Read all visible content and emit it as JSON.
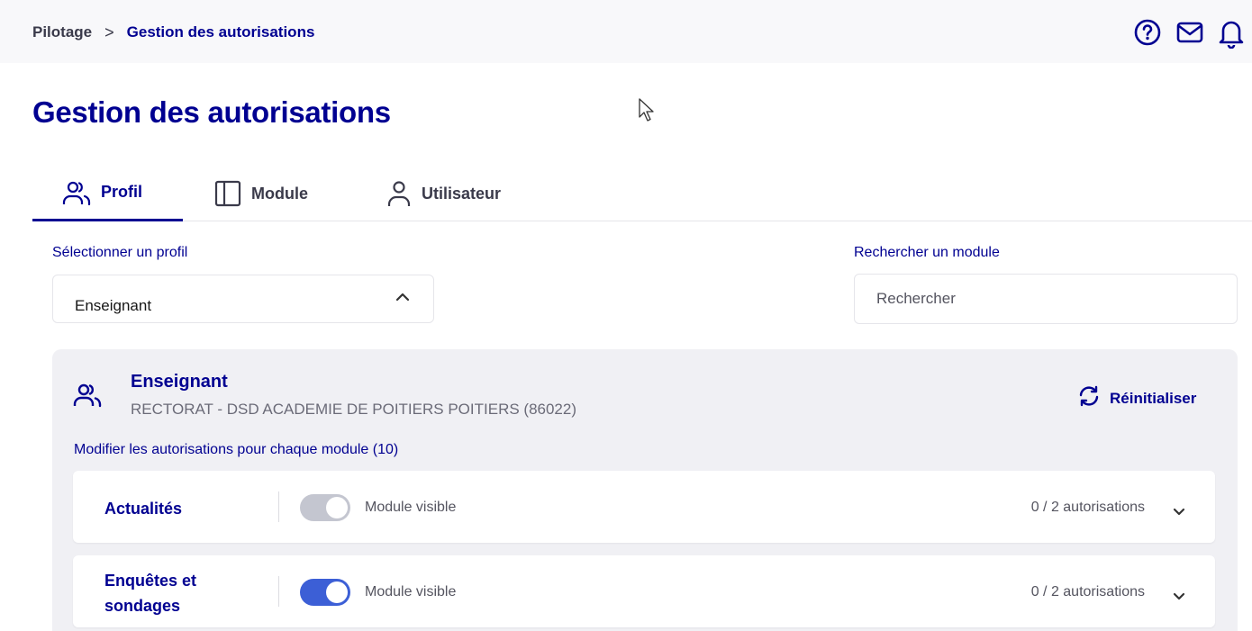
{
  "breadcrumb": {
    "parent": "Pilotage",
    "separator": ">",
    "current": "Gestion des autorisations"
  },
  "header_icons": [
    "help-icon",
    "mail-icon",
    "bell-icon"
  ],
  "page": {
    "title": "Gestion des autorisations"
  },
  "tabs": [
    {
      "label": "Profil",
      "icon": "users-icon",
      "active": true
    },
    {
      "label": "Module",
      "icon": "panel-icon",
      "active": false
    },
    {
      "label": "Utilisateur",
      "icon": "user-icon",
      "active": false
    }
  ],
  "profile_select": {
    "label": "Sélectionner un profil",
    "value": "Enseignant"
  },
  "module_search": {
    "label": "Rechercher un module",
    "placeholder": "Rechercher"
  },
  "profile": {
    "name": "Enseignant",
    "subtitle": "RECTORAT - DSD ACADEMIE DE POITIERS POITIERS (86022)",
    "reset_label": "Réinitialiser",
    "modules_heading": "Modifier les autorisations pour chaque module (10)"
  },
  "modules": [
    {
      "name": "Actualités",
      "visible_label": "Module visible",
      "visible": false,
      "count": "0 / 2 autorisations"
    },
    {
      "name": "Enquêtes et sondages",
      "name_line1": "Enquêtes et",
      "name_line2": "sondages",
      "visible_label": "Module visible",
      "visible": true,
      "count": "0 / 2 autorisations"
    }
  ],
  "colors": {
    "primary": "#000091",
    "toggle_on": "#3c5fd6",
    "toggle_off": "#c4c6d0",
    "panel_bg": "#f0f0f4"
  }
}
